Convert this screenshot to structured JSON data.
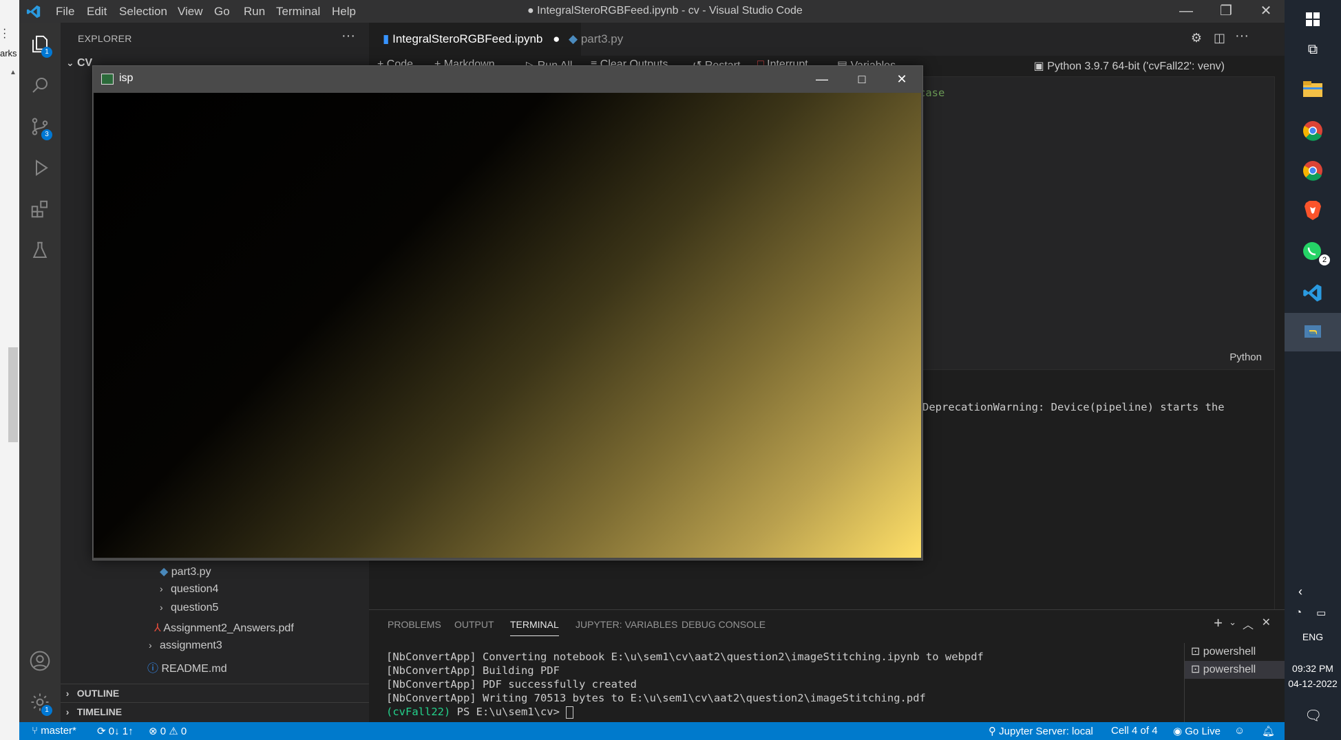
{
  "edge": {
    "text": "arks"
  },
  "titlebar": {
    "menu": [
      "File",
      "Edit",
      "Selection",
      "View",
      "Go",
      "Run",
      "Terminal",
      "Help"
    ],
    "title": "● IntegralSteroRGBFeed.ipynb - cv - Visual Studio Code"
  },
  "activity": {
    "explorer_badge": "1",
    "scm_badge": "3",
    "settings_badge": "1"
  },
  "explorer": {
    "header": "EXPLORER",
    "root": "CV",
    "items": [
      "part3.py",
      "question4",
      "question5",
      "Assignment2_Answers.pdf",
      "assignment3",
      "README.md"
    ],
    "outline": "OUTLINE",
    "timeline": "TIMELINE"
  },
  "tabs": {
    "active": "IntegralSteroRGBFeed.ipynb",
    "other": "part3.py"
  },
  "toolbar": {
    "code": "Code",
    "markdown": "Markdown",
    "run_all": "Run All",
    "clear": "Clear Outputs",
    "restart": "Restart",
    "interrupt": "Interrupt",
    "variables": "Variables",
    "kernel": "Python 3.9.7 64-bit ('cvFall22': venv)"
  },
  "notebook": {
    "code_fragment": "case",
    "cell_language": "Python",
    "output_fragment": "DeprecationWarning: Device(pipeline) starts the"
  },
  "panel": {
    "tabs": [
      "PROBLEMS",
      "OUTPUT",
      "TERMINAL",
      "JUPYTER: VARIABLES",
      "DEBUG CONSOLE"
    ],
    "terminal": [
      "[NbConvertApp] Converting notebook E:\\u\\sem1\\cv\\aat2\\question2\\imageStitching.ipynb to webpdf",
      "[NbConvertApp] Building PDF",
      "[NbConvertApp] PDF successfully created",
      "[NbConvertApp] Writing 70513 bytes to E:\\u\\sem1\\cv\\aat2\\question2\\imageStitching.pdf"
    ],
    "prompt_env": "(cvFall22)",
    "prompt": " PS E:\\u\\sem1\\cv> ",
    "shells": [
      "powershell",
      "powershell"
    ]
  },
  "statusbar": {
    "branch": "master*",
    "sync": "0↓ 1↑",
    "errors": "0",
    "warnings": "0",
    "jupyter": "Jupyter Server: local",
    "cell": "Cell 4 of 4",
    "golive": "Go Live"
  },
  "taskbar": {
    "lang": "ENG",
    "time": "09:32 PM",
    "date": "04-12-2022",
    "whatsapp_badge": "2"
  },
  "isp": {
    "title": "isp"
  },
  "colors": {
    "accent": "#007acc",
    "titlebar": "#323233",
    "editor": "#1e1e1e",
    "sidebar": "#252526"
  }
}
